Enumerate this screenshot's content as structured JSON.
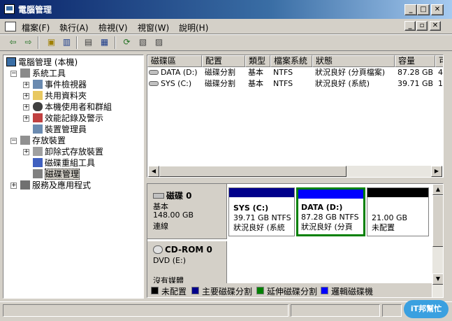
{
  "window": {
    "title": "電腦管理"
  },
  "menu": [
    {
      "label": "檔案(F)"
    },
    {
      "label": "執行(A)"
    },
    {
      "label": "檢視(V)"
    },
    {
      "label": "視窗(W)"
    },
    {
      "label": "說明(H)"
    }
  ],
  "tree": {
    "root": "電腦管理 (本機)",
    "system_tools": "系統工具",
    "event_viewer": "事件檢視器",
    "shared_folders": "共用資料夾",
    "local_users": "本機使用者和群組",
    "perf_logs": "效能記錄及警示",
    "device_manager": "裝置管理員",
    "storage": "存放裝置",
    "removable": "卸除式存放裝置",
    "defrag": "磁碟重組工具",
    "disk_mgmt": "磁碟管理",
    "services": "服務及應用程式"
  },
  "list": {
    "columns": [
      "磁碟區",
      "配置",
      "類型",
      "檔案系統",
      "狀態",
      "容量",
      "可"
    ],
    "rows": [
      {
        "volume": "DATA (D:)",
        "layout": "磁碟分割",
        "type": "基本",
        "fs": "NTFS",
        "status": "狀況良好 (分頁檔案)",
        "capacity": "87.28 GB",
        "free": "4"
      },
      {
        "volume": "SYS (C:)",
        "layout": "磁碟分割",
        "type": "基本",
        "fs": "NTFS",
        "status": "狀況良好 (系統)",
        "capacity": "39.71 GB",
        "free": "1."
      }
    ]
  },
  "disks": [
    {
      "name": "磁碟 0",
      "type": "基本",
      "size": "148.00 GB",
      "state": "連線",
      "partitions": [
        {
          "title": "SYS  (C:)",
          "size": "39.71 GB NTFS",
          "status": "狀況良好 (系統",
          "color": "#00008b"
        },
        {
          "title": "DATA  (D:)",
          "size": "87.28 GB NTFS",
          "status": "狀況良好 (分頁",
          "color": "#0000ff"
        },
        {
          "title": "",
          "size": "21.00 GB",
          "status": "未配置",
          "color": "#000000"
        }
      ]
    },
    {
      "name": "CD-ROM 0",
      "type": "DVD (E:)",
      "state": "沒有媒體"
    }
  ],
  "legend": [
    {
      "label": "未配置",
      "color": "#000000"
    },
    {
      "label": "主要磁碟分割",
      "color": "#00008b"
    },
    {
      "label": "延伸磁碟分割",
      "color": "#008000"
    },
    {
      "label": "邏輯磁碟機",
      "color": "#0000ff"
    }
  ],
  "watermark": {
    "text": "iT邦幫忙"
  }
}
